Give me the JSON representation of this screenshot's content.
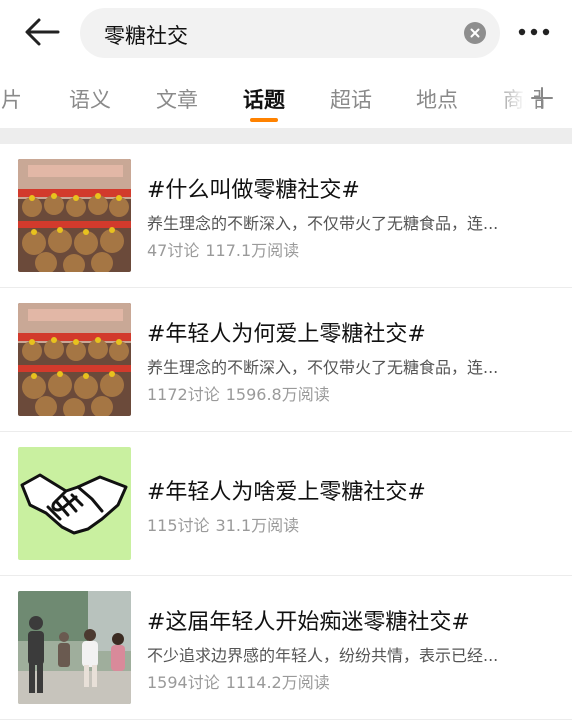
{
  "header": {
    "search_query": "零糖社交"
  },
  "tabs": [
    {
      "label": "图片"
    },
    {
      "label": "语义"
    },
    {
      "label": "文章"
    },
    {
      "label": "话题",
      "active": true
    },
    {
      "label": "超话"
    },
    {
      "label": "地点"
    },
    {
      "label": "商品"
    }
  ],
  "results": [
    {
      "title": "#什么叫做零糖社交#",
      "description": "养生理念的不断深入，不仅带火了无糖食品，连...",
      "discussions": "47讨论",
      "reads": "117.1万阅读",
      "thumbnail": "plush-toys-display"
    },
    {
      "title": "#年轻人为何爱上零糖社交#",
      "description": "养生理念的不断深入，不仅带火了无糖食品，连...",
      "discussions": "1172讨论",
      "reads": "1596.8万阅读",
      "thumbnail": "plush-toys-display"
    },
    {
      "title": "#年轻人为啥爱上零糖社交#",
      "description": "",
      "discussions": "115讨论",
      "reads": "31.1万阅读",
      "thumbnail": "handshake-icon"
    },
    {
      "title": "#这届年轻人开始痴迷零糖社交#",
      "description": "不少追求边界感的年轻人，纷纷共情，表示已经...",
      "discussions": "1594讨论",
      "reads": "1114.2万阅读",
      "thumbnail": "people-street-photo"
    }
  ],
  "colors": {
    "accent": "#ff8200",
    "handshake_bg": "#c9f0a0"
  }
}
